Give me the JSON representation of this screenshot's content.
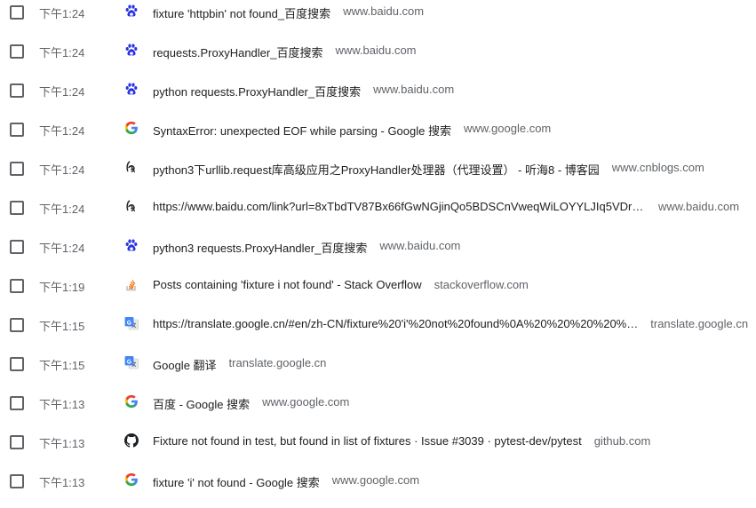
{
  "history": {
    "entries": [
      {
        "time": "下午1:24",
        "icon": "baidu-paw-icon",
        "title": "fixture 'httpbin' not found_百度搜索",
        "domain": "www.baidu.com"
      },
      {
        "time": "下午1:24",
        "icon": "baidu-paw-icon",
        "title": "requests.ProxyHandler_百度搜索",
        "domain": "www.baidu.com"
      },
      {
        "time": "下午1:24",
        "icon": "baidu-paw-icon",
        "title": "python requests.ProxyHandler_百度搜索",
        "domain": "www.baidu.com"
      },
      {
        "time": "下午1:24",
        "icon": "google-g-icon",
        "title": "SyntaxError: unexpected EOF while parsing - Google 搜索",
        "domain": "www.google.com"
      },
      {
        "time": "下午1:24",
        "icon": "cnblogs-icon",
        "title": "python3下urllib.request库高级应用之ProxyHandler处理器（代理设置） - 听海8 - 博客园",
        "domain": "www.cnblogs.com"
      },
      {
        "time": "下午1:24",
        "icon": "cnblogs-icon",
        "title": "https://www.baidu.com/link?url=8xTbdTV87Bx66fGwNGjinQo5BDSCnVweqWiLOYYLJIq5VDrB…",
        "domain": "www.baidu.com"
      },
      {
        "time": "下午1:24",
        "icon": "baidu-paw-icon",
        "title": "python3 requests.ProxyHandler_百度搜索",
        "domain": "www.baidu.com"
      },
      {
        "time": "下午1:19",
        "icon": "stackoverflow-icon",
        "title": "Posts containing 'fixture i not found' - Stack Overflow",
        "domain": "stackoverflow.com"
      },
      {
        "time": "下午1:15",
        "icon": "google-translate-icon",
        "title": "https://translate.google.cn/#en/zh-CN/fixture%20'i'%20not%20found%0A%20%20%20%20%…",
        "domain": "translate.google.cn"
      },
      {
        "time": "下午1:15",
        "icon": "google-translate-icon",
        "title": "Google 翻译",
        "domain": "translate.google.cn"
      },
      {
        "time": "下午1:13",
        "icon": "google-g-icon",
        "title": "百度 - Google 搜索",
        "domain": "www.google.com"
      },
      {
        "time": "下午1:13",
        "icon": "github-icon",
        "title": "Fixture not found in test, but found in list of fixtures · Issue #3039 · pytest-dev/pytest",
        "domain": "github.com"
      },
      {
        "time": "下午1:13",
        "icon": "google-g-icon",
        "title": "fixture 'i' not found - Google 搜索",
        "domain": "www.google.com"
      }
    ]
  },
  "colors": {
    "baidu_blue": "#2932e1",
    "google_blue": "#4285f4",
    "google_red": "#ea4335",
    "google_yellow": "#fbbc05",
    "google_green": "#34a853",
    "stackoverflow_orange": "#f48024",
    "github_black": "#1b1f23",
    "text_primary": "#202124",
    "text_secondary": "#5f6368"
  }
}
